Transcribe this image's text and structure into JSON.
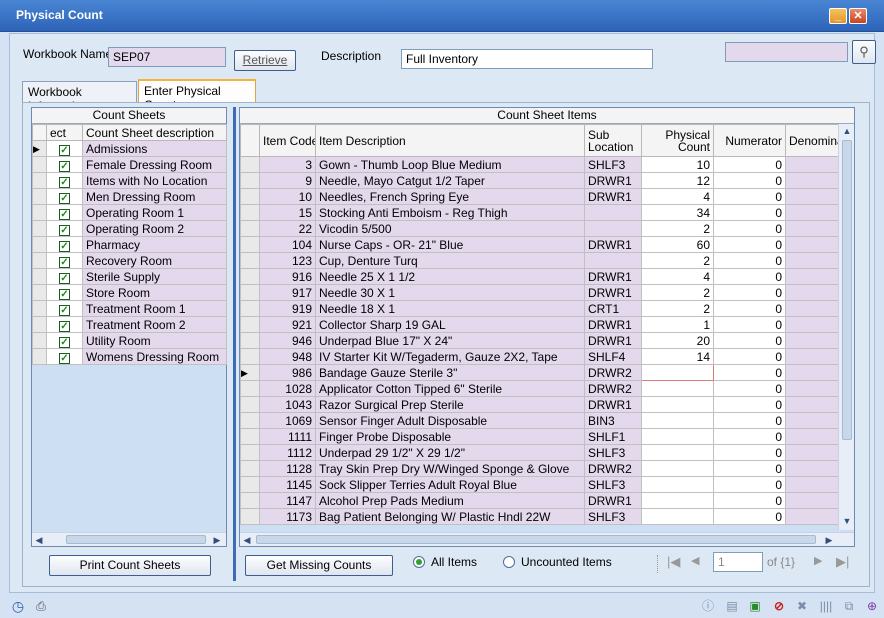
{
  "window": {
    "title": "Physical Count"
  },
  "header": {
    "workbook_label": "Workbook Name",
    "workbook_value": "SEP07",
    "retrieve_label": "Retrieve",
    "description_label": "Description",
    "description_value": "Full Inventory",
    "search_value": ""
  },
  "tabs": [
    {
      "label": "Workbook Information"
    },
    {
      "label": "Enter Physical Counts"
    }
  ],
  "count_sheets": {
    "title": "Count Sheets",
    "col_select": "ect",
    "col_desc": "Count Sheet description",
    "rows": [
      "Admissions",
      "Female Dressing Room",
      "Items with No Location",
      "Men Dressing Room",
      "Operating Room 1",
      "Operating Room 2",
      "Pharmacy",
      "Recovery Room",
      "Sterile Supply",
      "Store Room",
      "Treatment Room 1",
      "Treatment Room 2",
      "Utility Room",
      "Womens Dressing Room"
    ]
  },
  "items": {
    "title": "Count Sheet Items",
    "col_code": "Item Code",
    "col_desc": "Item Description",
    "col_sub": "Sub Location",
    "col_phys": "Physical Count",
    "col_num": "Numerator",
    "col_den": "Denomina",
    "rows": [
      [
        "3",
        "Gown - Thumb Loop Blue Medium",
        "SHLF3",
        "10",
        "0"
      ],
      [
        "9",
        "Needle, Mayo Catgut 1/2 Taper",
        "DRWR1",
        "12",
        "0"
      ],
      [
        "10",
        "Needles, French Spring Eye",
        "DRWR1",
        "4",
        "0"
      ],
      [
        "15",
        "Stocking Anti Emboism - Reg Thigh",
        "",
        "34",
        "0"
      ],
      [
        "22",
        "Vicodin 5/500",
        "",
        "2",
        "0"
      ],
      [
        "104",
        "Nurse Caps - OR- 21\"  Blue",
        "DRWR1",
        "60",
        "0"
      ],
      [
        "123",
        "Cup, Denture Turq",
        "",
        "2",
        "0"
      ],
      [
        "916",
        "Needle 25 X 1 1/2",
        "DRWR1",
        "4",
        "0"
      ],
      [
        "917",
        "Needle 30 X 1",
        "DRWR1",
        "2",
        "0"
      ],
      [
        "919",
        "Needle 18 X 1",
        "CRT1",
        "2",
        "0"
      ],
      [
        "921",
        "Collector Sharp  19 GAL",
        "DRWR1",
        "1",
        "0"
      ],
      [
        "946",
        "Underpad Blue 17\"  X 24\"",
        "DRWR1",
        "20",
        "0"
      ],
      [
        "948",
        "IV Starter Kit W/Tegaderm, Gauze 2X2, Tape",
        "SHLF4",
        "14",
        "0"
      ],
      [
        "986",
        "Bandage Gauze Sterile 3\"",
        "DRWR2",
        "",
        "0"
      ],
      [
        "1028",
        "Applicator Cotton Tipped 6\" Sterile",
        "DRWR2",
        "",
        "0"
      ],
      [
        "1043",
        "Razor Surgical Prep Sterile",
        "DRWR1",
        "",
        "0"
      ],
      [
        "1069",
        "Sensor Finger Adult Disposable",
        "BIN3",
        "",
        "0"
      ],
      [
        "1111",
        "Finger Probe Disposable",
        "SHLF1",
        "",
        "0"
      ],
      [
        "1112",
        "Underpad 29 1/2\" X 29 1/2\"",
        "SHLF3",
        "",
        "0"
      ],
      [
        "1128",
        "Tray Skin Prep Dry W/Winged Sponge & Glove",
        "DRWR2",
        "",
        "0"
      ],
      [
        "1145",
        "Sock Slipper Terries Adult Royal Blue",
        "SHLF3",
        "",
        "0"
      ],
      [
        "1147",
        "Alcohol Prep Pads Medium",
        "DRWR1",
        "",
        "0"
      ],
      [
        "1173",
        "Bag Patient Belonging W/ Plastic Hndl 22W",
        "SHLF3",
        "",
        "0"
      ]
    ]
  },
  "footer": {
    "print_label": "Print Count Sheets",
    "missing_label": "Get Missing Counts",
    "all_items": "All Items",
    "uncounted_items": "Uncounted Items",
    "page_value": "1",
    "page_of": "of {1}"
  }
}
